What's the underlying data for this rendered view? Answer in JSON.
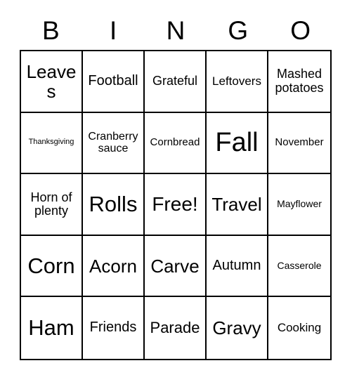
{
  "card": {
    "title": "BINGO",
    "header_letters": [
      "B",
      "I",
      "N",
      "G",
      "O"
    ],
    "grid_rows": 5,
    "grid_cols": 5,
    "free_space": "Free!",
    "colors": {
      "background": "#ffffff",
      "grid_line": "#000000",
      "text": "#000000"
    },
    "cells": [
      {
        "label": "Leaves",
        "size_class": "fs-26",
        "column": "B",
        "row": 1,
        "free": false
      },
      {
        "label": "Football",
        "size_class": "fs-20",
        "column": "I",
        "row": 1,
        "free": false
      },
      {
        "label": "Grateful",
        "size_class": "fs-18",
        "column": "N",
        "row": 1,
        "free": false
      },
      {
        "label": "Leftovers",
        "size_class": "fs-17",
        "column": "G",
        "row": 1,
        "free": false
      },
      {
        "label": "Mashed potatoes",
        "size_class": "fs-18",
        "column": "O",
        "row": 1,
        "free": false
      },
      {
        "label": "Thanksgiving",
        "size_class": "fs-11",
        "column": "B",
        "row": 2,
        "free": false
      },
      {
        "label": "Cranberry sauce",
        "size_class": "fs-16",
        "column": "I",
        "row": 2,
        "free": false
      },
      {
        "label": "Cornbread",
        "size_class": "fs-15",
        "column": "N",
        "row": 2,
        "free": false
      },
      {
        "label": "Fall",
        "size_class": "fs-38",
        "column": "G",
        "row": 2,
        "free": false
      },
      {
        "label": "November",
        "size_class": "fs-15",
        "column": "O",
        "row": 2,
        "free": false
      },
      {
        "label": "Horn of plenty",
        "size_class": "fs-18",
        "column": "B",
        "row": 3,
        "free": false
      },
      {
        "label": "Rolls",
        "size_class": "fs-31",
        "column": "I",
        "row": 3,
        "free": false
      },
      {
        "label": "Free!",
        "size_class": "fs-28",
        "column": "N",
        "row": 3,
        "free": true
      },
      {
        "label": "Travel",
        "size_class": "fs-26",
        "column": "G",
        "row": 3,
        "free": false
      },
      {
        "label": "Mayflower",
        "size_class": "fs-14",
        "column": "O",
        "row": 3,
        "free": false
      },
      {
        "label": "Corn",
        "size_class": "fs-31",
        "column": "B",
        "row": 4,
        "free": false
      },
      {
        "label": "Acorn",
        "size_class": "fs-26",
        "column": "I",
        "row": 4,
        "free": false
      },
      {
        "label": "Carve",
        "size_class": "fs-26",
        "column": "N",
        "row": 4,
        "free": false
      },
      {
        "label": "Autumn",
        "size_class": "fs-20",
        "column": "G",
        "row": 4,
        "free": false
      },
      {
        "label": "Casserole",
        "size_class": "fs-14",
        "column": "O",
        "row": 4,
        "free": false
      },
      {
        "label": "Ham",
        "size_class": "fs-31",
        "column": "B",
        "row": 5,
        "free": false
      },
      {
        "label": "Friends",
        "size_class": "fs-20",
        "column": "I",
        "row": 5,
        "free": false
      },
      {
        "label": "Parade",
        "size_class": "fs-22",
        "column": "N",
        "row": 5,
        "free": false
      },
      {
        "label": "Gravy",
        "size_class": "fs-26",
        "column": "G",
        "row": 5,
        "free": false
      },
      {
        "label": "Cooking",
        "size_class": "fs-17",
        "column": "O",
        "row": 5,
        "free": false
      }
    ]
  }
}
